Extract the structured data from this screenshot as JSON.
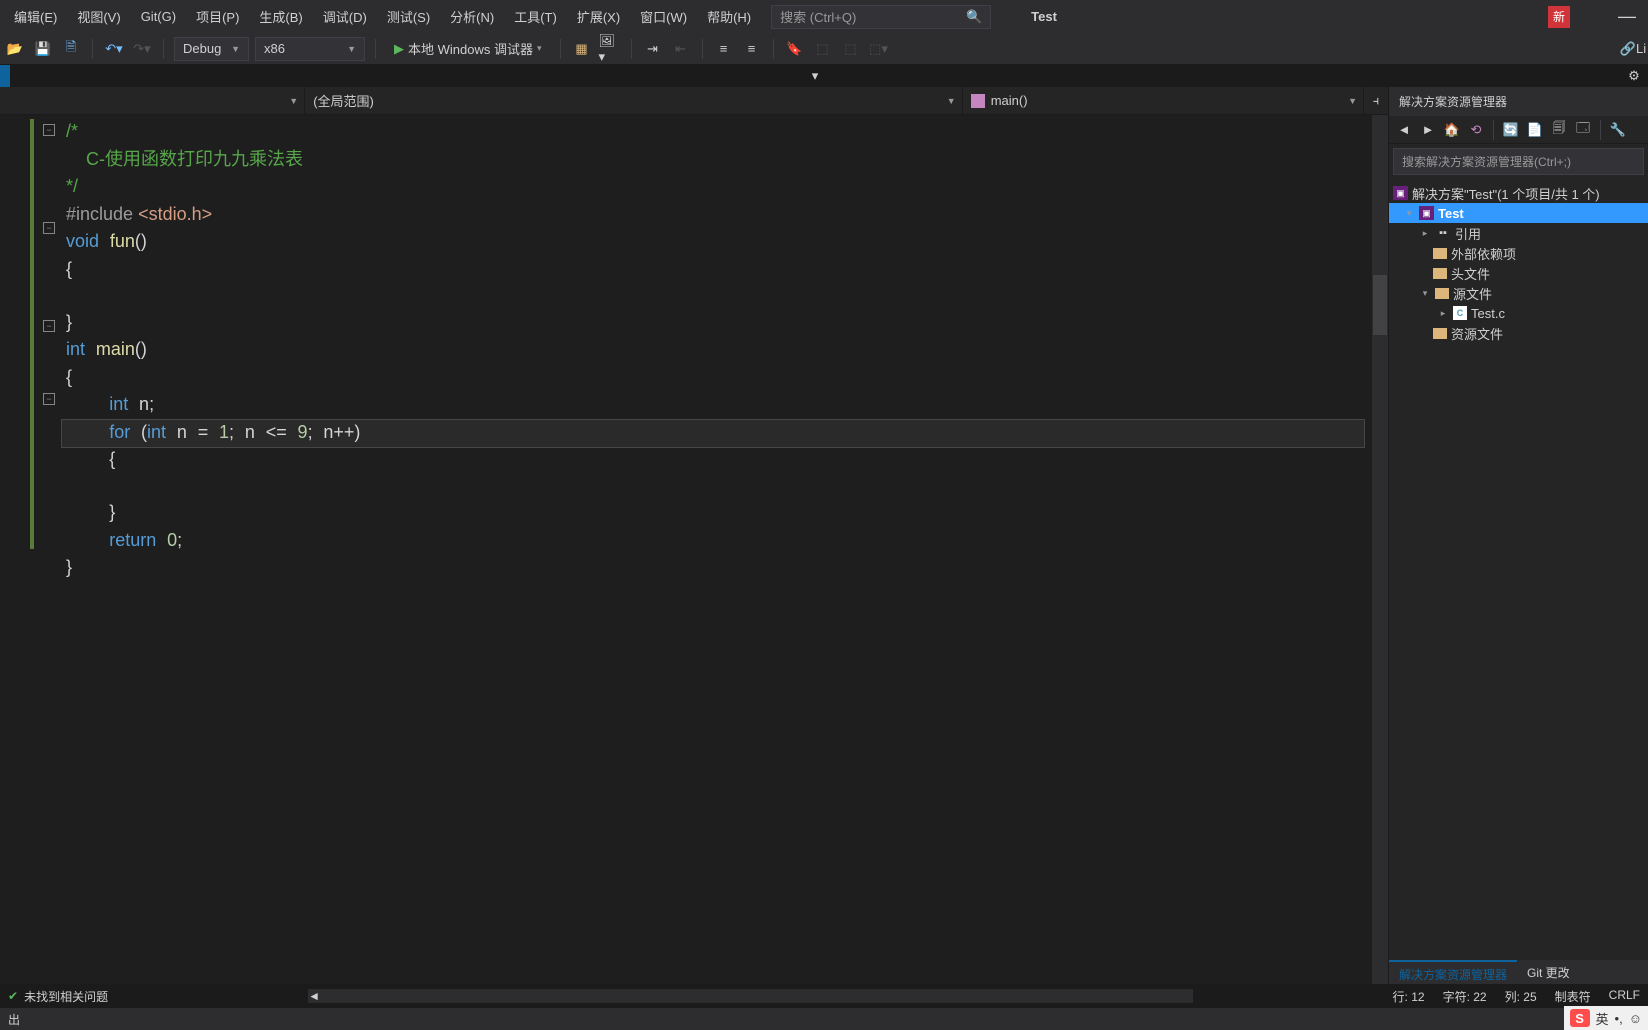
{
  "menu": {
    "items": [
      "编辑(E)",
      "视图(V)",
      "Git(G)",
      "项目(P)",
      "生成(B)",
      "调试(D)",
      "测试(S)",
      "分析(N)",
      "工具(T)",
      "扩展(X)",
      "窗口(W)",
      "帮助(H)"
    ],
    "search_placeholder": "搜索 (Ctrl+Q)",
    "app_title": "Test",
    "new_badge": "新"
  },
  "toolbar": {
    "config": "Debug",
    "platform": "x86",
    "debugger": "本地 Windows 调试器",
    "live_share": "Li"
  },
  "navbar": {
    "scope": "(全局范围)",
    "func": "main()"
  },
  "code": {
    "lines": [
      {
        "t": "comment",
        "text": "/*",
        "fold": "minus"
      },
      {
        "t": "comment",
        "text": "    C-使用函数打印九九乘法表"
      },
      {
        "t": "comment",
        "text": "*/"
      },
      {
        "t": "preproc",
        "text": "#include <stdio.h>"
      },
      {
        "t": "funcdef",
        "text": "void fun()",
        "fold": "minus"
      },
      {
        "t": "brace",
        "text": "{"
      },
      {
        "t": "blank",
        "text": ""
      },
      {
        "t": "brace",
        "text": "}"
      },
      {
        "t": "funcdef2",
        "text": "int main()",
        "fold": "minus"
      },
      {
        "t": "brace",
        "text": "{"
      },
      {
        "t": "stmt",
        "text": "    int n;"
      },
      {
        "t": "for",
        "text": "    for (int n = 1; n <= 9; n++)",
        "fold": "minus",
        "current": true
      },
      {
        "t": "brace",
        "text": "    {"
      },
      {
        "t": "blank",
        "text": ""
      },
      {
        "t": "brace",
        "text": "    }"
      },
      {
        "t": "return",
        "text": "    return 0;"
      },
      {
        "t": "brace",
        "text": "}"
      }
    ]
  },
  "solution": {
    "panel_title": "解决方案资源管理器",
    "search_placeholder": "搜索解决方案资源管理器(Ctrl+;)",
    "root": "解决方案\"Test\"(1 个项目/共 1 个)",
    "project": "Test",
    "nodes": {
      "refs": "引用",
      "external": "外部依赖项",
      "headers": "头文件",
      "sources": "源文件",
      "file": "Test.c",
      "resources": "资源文件"
    },
    "tabs": {
      "active": "解决方案资源管理器",
      "other": "Git 更改"
    }
  },
  "status": {
    "issues": "未找到相关问题",
    "line": "行: 12",
    "char": "字符: 22",
    "col": "列: 25",
    "tabs": "制表符",
    "crlf": "CRLF"
  },
  "output": {
    "label": "出"
  },
  "ime": {
    "s": "S",
    "lang": "英",
    "punct": "•,",
    "emoji": "☺"
  }
}
